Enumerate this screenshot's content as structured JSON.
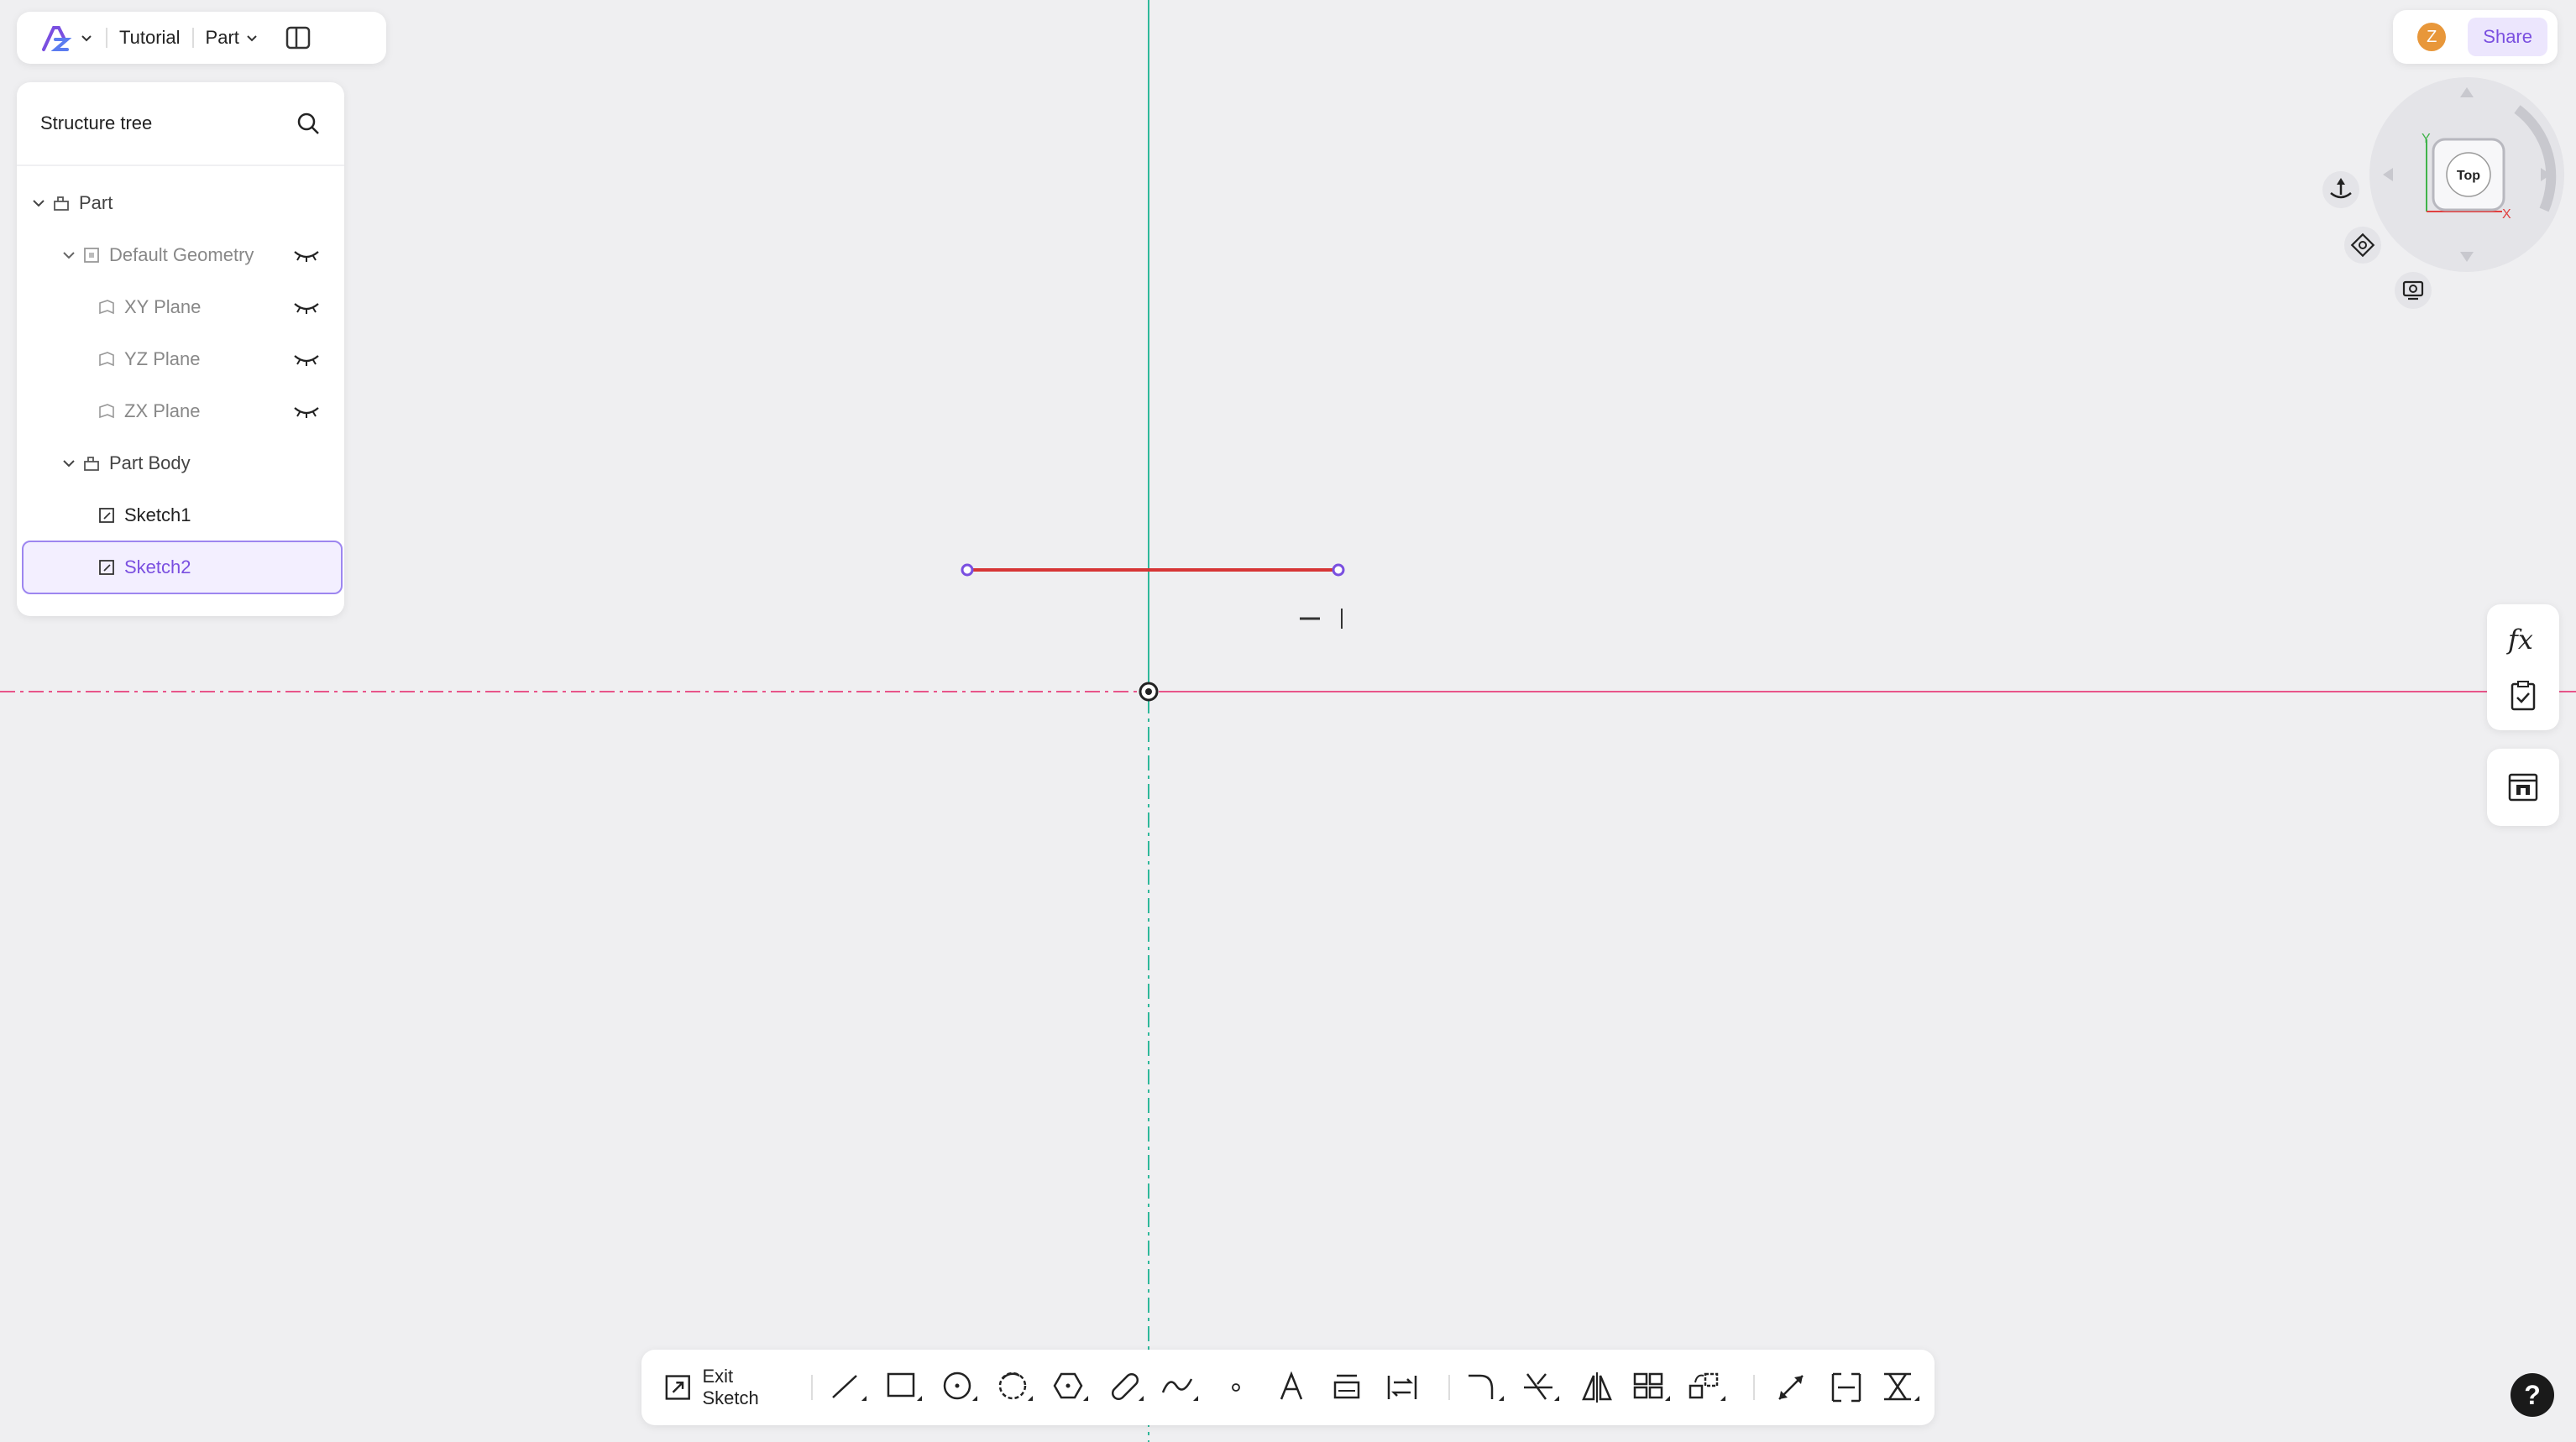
{
  "topbar": {
    "project": "Tutorial",
    "mode": "Part"
  },
  "tree": {
    "title": "Structure tree",
    "items": [
      {
        "label": "Part"
      },
      {
        "label": "Default Geometry"
      },
      {
        "label": "XY Plane"
      },
      {
        "label": "YZ Plane"
      },
      {
        "label": "ZX Plane"
      },
      {
        "label": "Part Body"
      },
      {
        "label": "Sketch1"
      },
      {
        "label": "Sketch2"
      }
    ]
  },
  "user": {
    "avatar_initial": "Z",
    "share_label": "Share"
  },
  "viewcube": {
    "face": "Top",
    "axis_y": "Y",
    "axis_x": "X"
  },
  "toolbar": {
    "exit_sketch": "Exit Sketch"
  },
  "help": {
    "label": "?"
  },
  "colors": {
    "accent": "#7a4fe0",
    "sketch_line": "#d63535",
    "x_axis": "#e8558a",
    "y_axis": "#2fb89a"
  }
}
